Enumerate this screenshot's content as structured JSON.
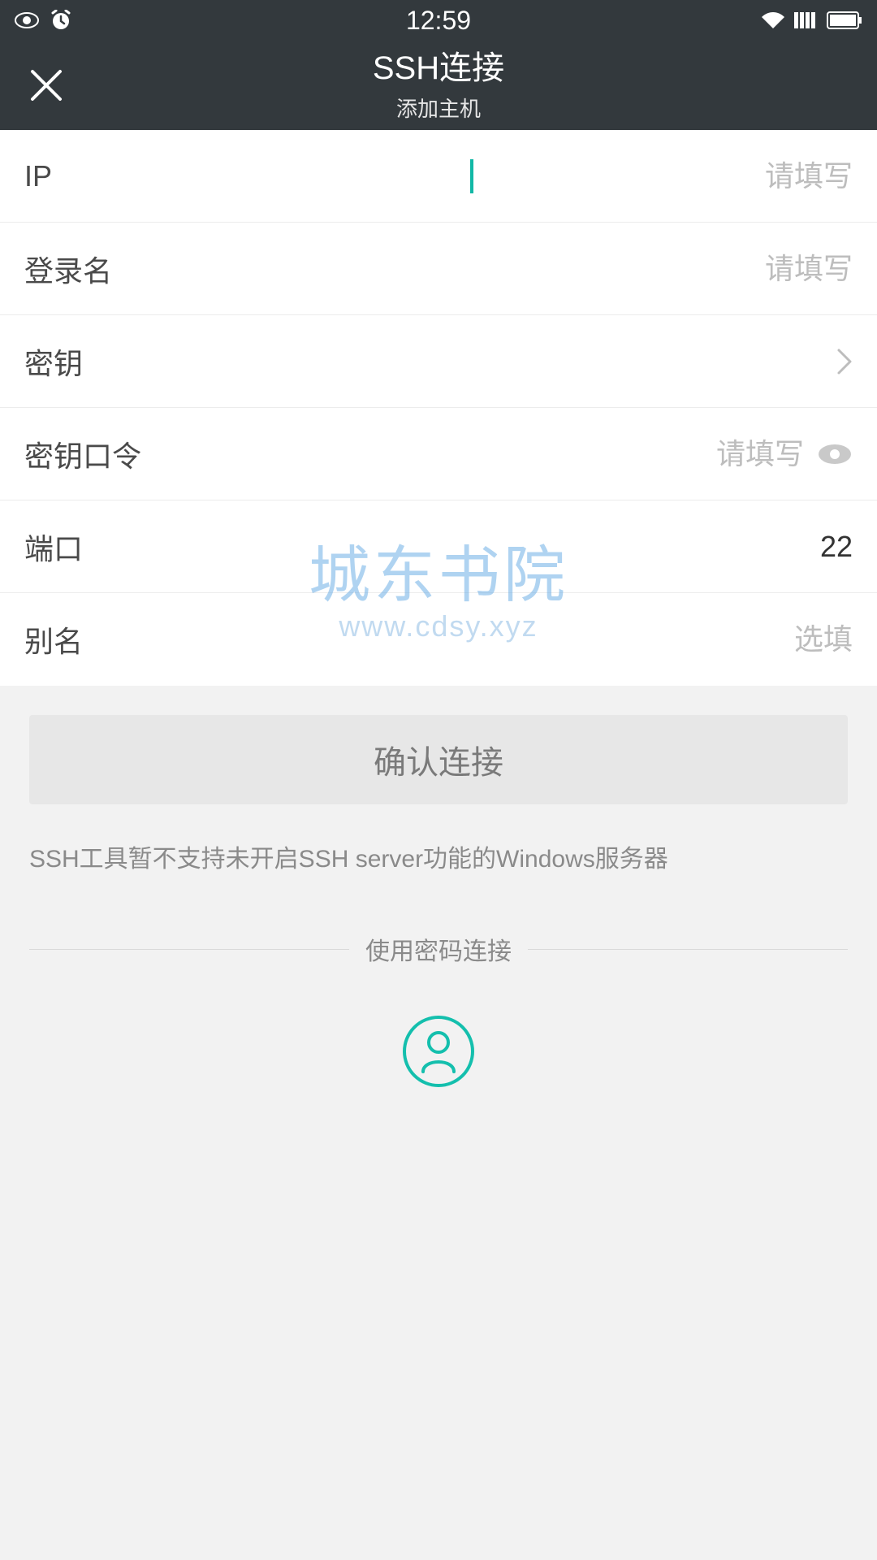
{
  "status": {
    "time": "12:59"
  },
  "header": {
    "title": "SSH连接",
    "subtitle": "添加主机"
  },
  "form": {
    "ip": {
      "label": "IP",
      "placeholder": "请填写",
      "value": ""
    },
    "login": {
      "label": "登录名",
      "placeholder": "请填写",
      "value": ""
    },
    "key": {
      "label": "密钥"
    },
    "passphrase": {
      "label": "密钥口令",
      "placeholder": "请填写",
      "value": ""
    },
    "port": {
      "label": "端口",
      "value": "22"
    },
    "alias": {
      "label": "别名",
      "placeholder": "选填",
      "value": ""
    }
  },
  "actions": {
    "confirm": "确认连接",
    "note": "SSH工具暂不支持未开启SSH server功能的Windows服务器",
    "password_divider": "使用密码连接"
  },
  "watermark": {
    "line1": "城东书院",
    "line2": "www.cdsy.xyz"
  }
}
